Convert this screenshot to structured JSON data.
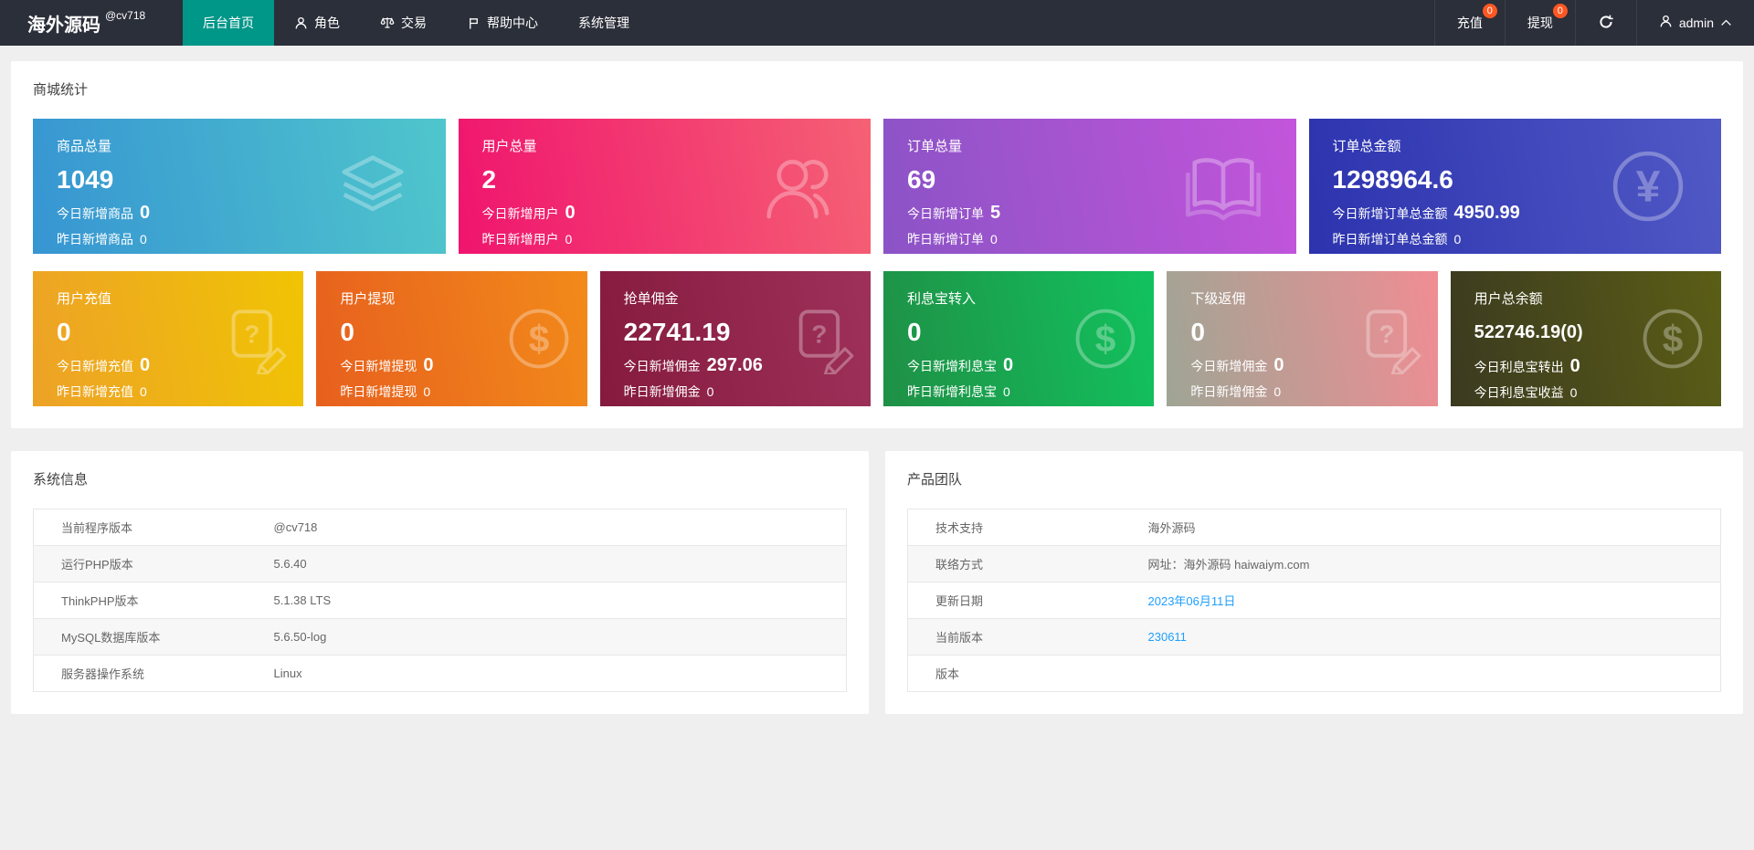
{
  "navbar": {
    "logo": "海外源码",
    "logo_badge": "@cv718",
    "menu": [
      {
        "label": "后台首页",
        "icon": null
      },
      {
        "label": "角色",
        "icon": "person-icon"
      },
      {
        "label": "交易",
        "icon": "scales-icon"
      },
      {
        "label": "帮助中心",
        "icon": "flag-icon"
      },
      {
        "label": "系统管理",
        "icon": null
      }
    ],
    "recharge": {
      "label": "充值",
      "badge": "0"
    },
    "withdraw": {
      "label": "提现",
      "badge": "0"
    },
    "refresh_icon": "refresh-icon",
    "user": {
      "name": "admin",
      "icon": "person-icon",
      "caret": "chevron-up-icon"
    }
  },
  "colors": {
    "navbar_bg": "#2B2F3A",
    "active_tab_teal": "#009688",
    "badge_orange": "#FF5722",
    "link_blue": "#1E9FFF"
  },
  "stats": {
    "title": "商城统计",
    "row1": [
      {
        "title": "商品总量",
        "value": "1049",
        "today_label": "今日新增商品",
        "today_value": "0",
        "yesterday_label": "昨日新增商品",
        "yesterday_value": "0",
        "icon": "layers-icon",
        "g": [
          "#3795D2",
          "#4FC6CC"
        ]
      },
      {
        "title": "用户总量",
        "value": "2",
        "today_label": "今日新增用户",
        "today_value": "0",
        "yesterday_label": "昨日新增用户",
        "yesterday_value": "0",
        "icon": "users-icon",
        "g": [
          "#F0146E",
          "#F56174"
        ]
      },
      {
        "title": "订单总量",
        "value": "69",
        "today_label": "今日新增订单",
        "today_value": "5",
        "yesterday_label": "昨日新增订单",
        "yesterday_value": "0",
        "icon": "open-book-icon",
        "g": [
          "#8B53C6",
          "#C355DB"
        ]
      },
      {
        "title": "订单总金额",
        "value": "1298964.6",
        "today_label": "今日新增订单总金额",
        "today_value": "4950.99",
        "yesterday_label": "昨日新增订单总金额",
        "yesterday_value": "0",
        "icon": "yen-circle-icon",
        "g": [
          "#2C33AE",
          "#5159C6"
        ]
      }
    ],
    "row2": [
      {
        "title": "用户充值",
        "value": "0",
        "today_label": "今日新增充值",
        "today_value": "0",
        "yesterday_label": "昨日新增充值",
        "yesterday_value": "0",
        "icon": "doc-question-pencil-icon",
        "g": [
          "#EDA227",
          "#F0C404"
        ]
      },
      {
        "title": "用户提现",
        "value": "0",
        "today_label": "今日新增提现",
        "today_value": "0",
        "yesterday_label": "昨日新增提现",
        "yesterday_value": "0",
        "icon": "dollar-circle-icon",
        "g": [
          "#E7601E",
          "#F28A1A"
        ]
      },
      {
        "title": "抢单佣金",
        "value": "22741.19",
        "today_label": "今日新增佣金",
        "today_value": "297.06",
        "yesterday_label": "昨日新增佣金",
        "yesterday_value": "0",
        "icon": "doc-question-pencil-icon",
        "g": [
          "#851A3E",
          "#9E3159"
        ]
      },
      {
        "title": "利息宝转入",
        "value": "0",
        "today_label": "今日新增利息宝",
        "today_value": "0",
        "yesterday_label": "昨日新增利息宝",
        "yesterday_value": "0",
        "icon": "dollar-circle-icon",
        "g": [
          "#1F9046",
          "#12C25E"
        ]
      },
      {
        "title": "下级返佣",
        "value": "0",
        "today_label": "今日新增佣金",
        "today_value": "0",
        "yesterday_label": "昨日新增佣金",
        "yesterday_value": "0",
        "icon": "doc-question-pencil-icon",
        "g": [
          "#9FA595",
          "#F08D93"
        ]
      },
      {
        "title": "用户总余额",
        "value": "522746.19(0)",
        "today_label": "今日利息宝转出",
        "today_value": "0",
        "yesterday_label": "今日利息宝收益",
        "yesterday_value": "0",
        "icon": "dollar-circle-icon",
        "g": [
          "#3B3A20",
          "#5B5E16"
        ]
      }
    ]
  },
  "system_info": {
    "title": "系统信息",
    "rows": [
      {
        "label": "当前程序版本",
        "value": "@cv718"
      },
      {
        "label": "运行PHP版本",
        "value": "5.6.40"
      },
      {
        "label": "ThinkPHP版本",
        "value": "5.1.38 LTS"
      },
      {
        "label": "MySQL数据库版本",
        "value": "5.6.50-log"
      },
      {
        "label": "服务器操作系统",
        "value": "Linux"
      }
    ]
  },
  "product_team": {
    "title": "产品团队",
    "rows": [
      {
        "label": "技术支持",
        "value": "海外源码"
      },
      {
        "label": "联络方式",
        "value": "网址：海外源码 haiwaiym.com"
      },
      {
        "label": "更新日期",
        "value": "2023年06月11日"
      },
      {
        "label": "当前版本",
        "value": "230611"
      },
      {
        "label": "版本",
        "value": ""
      }
    ]
  }
}
